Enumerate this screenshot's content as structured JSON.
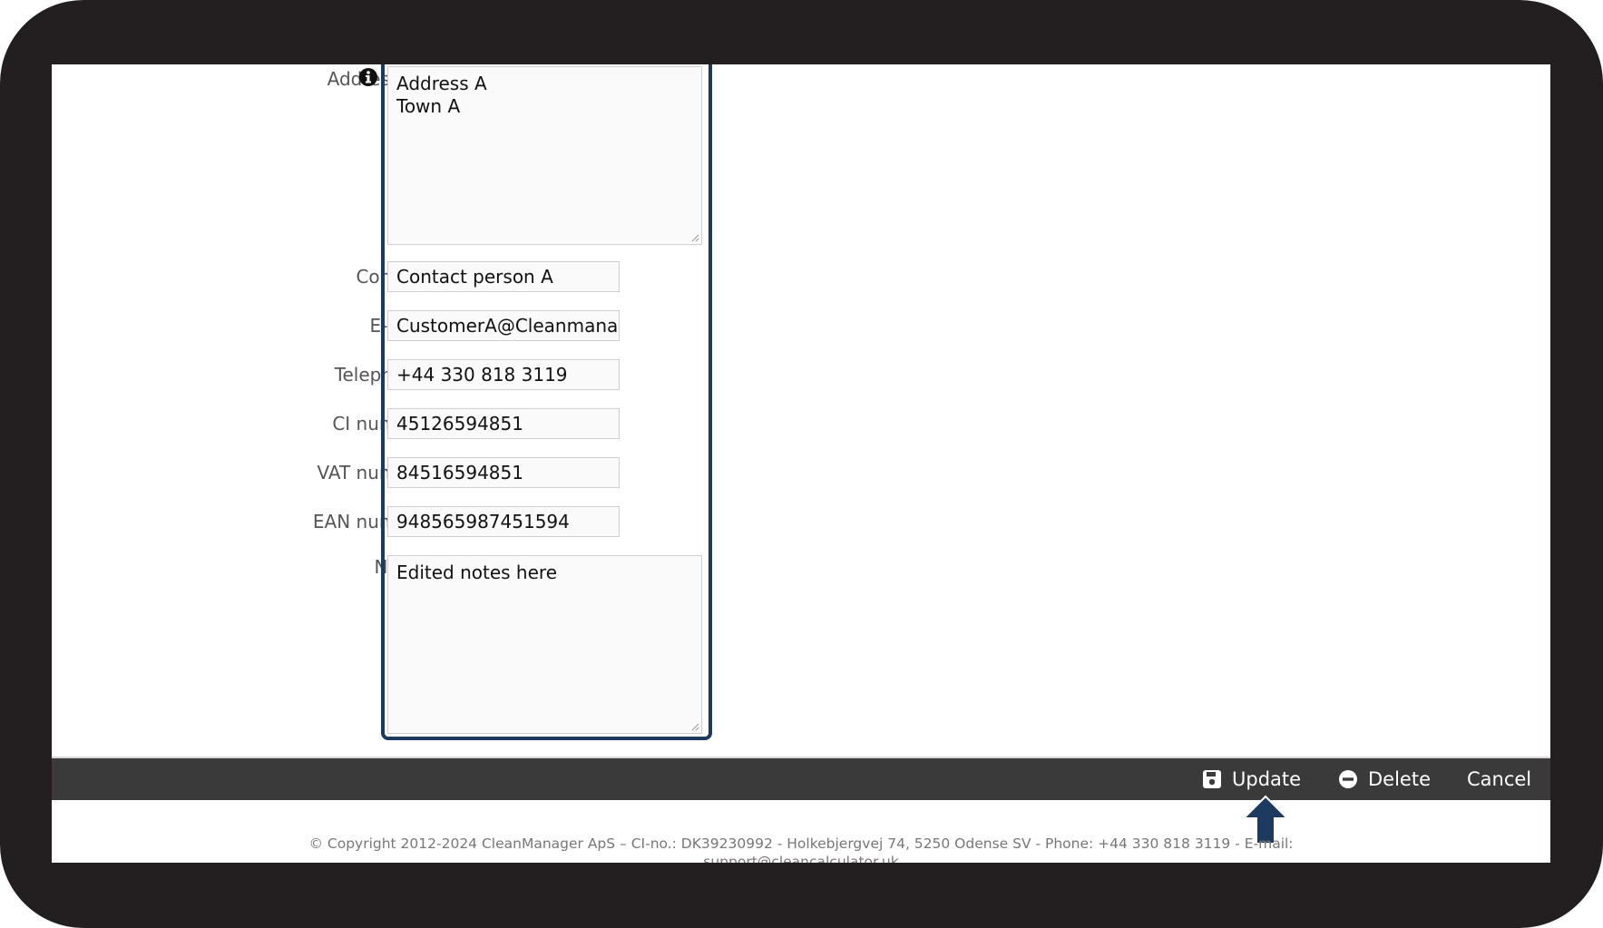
{
  "form": {
    "address_label": "Address:",
    "address_lines": [
      "Address A",
      "Town A"
    ],
    "contact_label": "Contact:",
    "contact_value": "Contact person A",
    "email_label": "E-mail:",
    "email_value": "CustomerA@Cleanmana",
    "telephone_label": "Telephone:",
    "telephone_value": "+44 330 818 3119",
    "ci_label": "CI number:",
    "ci_value": "45126594851",
    "vat_label": "VAT number:",
    "vat_value": "84516594851",
    "ean_label": "EAN number:",
    "ean_value": "948565987451594",
    "notes_label": "Notes:",
    "notes_value": "Edited notes here"
  },
  "toolbar": {
    "update_label": "Update",
    "delete_label": "Delete",
    "cancel_label": "Cancel"
  },
  "footer": {
    "line1": "© Copyright 2012-2024 CleanManager ApS – CI-no.: DK39230992 - Holkebjergvej 74, 5250 Odense SV - Phone: +44 330 818 3119 - E-mail:",
    "line2": "support@cleancalculator.uk"
  },
  "icons": {
    "address_info": "info-icon",
    "update": "save-icon",
    "delete": "minus-circle-icon",
    "pointer": "arrow-up-icon"
  },
  "colors": {
    "highlight": "#1e3a5f",
    "toolbar": "#3a3a3a",
    "frame": "#231f20"
  }
}
